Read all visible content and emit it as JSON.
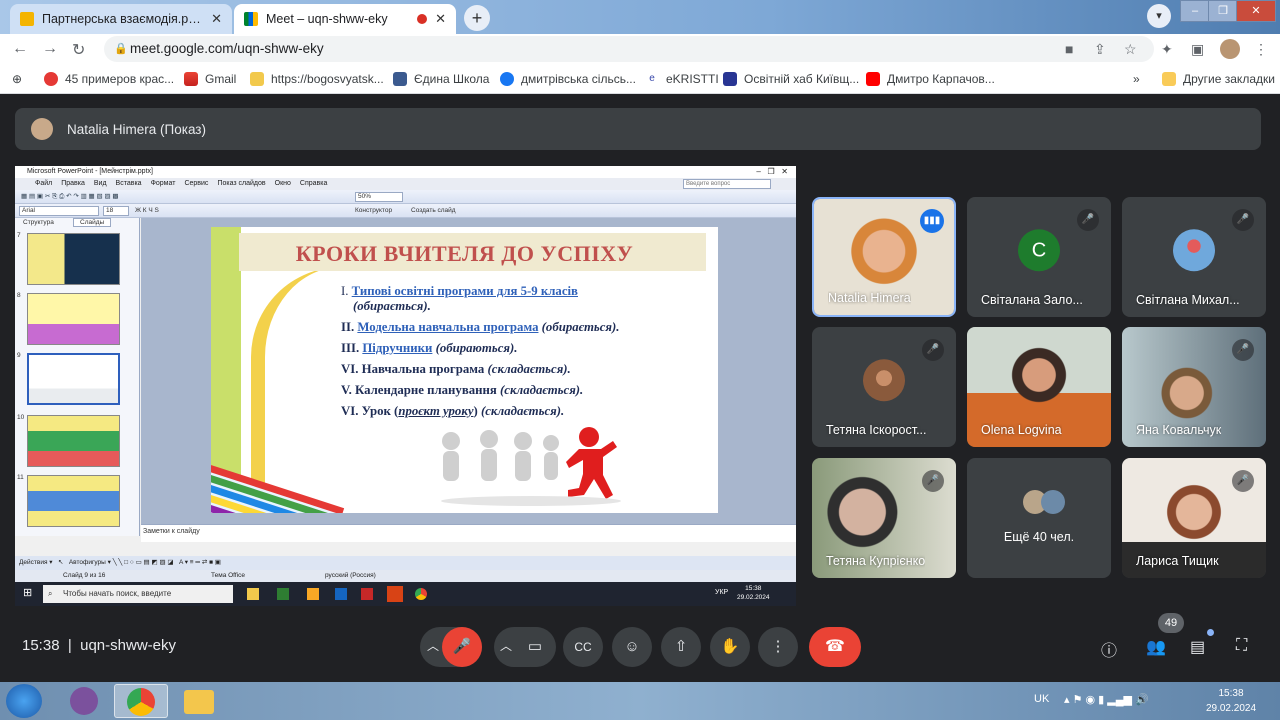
{
  "browser": {
    "tabs": [
      {
        "title": "Партнерська взаємодія.pptx - G",
        "active": false
      },
      {
        "title": "Meet – uqn-shww-eky",
        "active": true
      }
    ],
    "url": "meet.google.com/uqn-shww-eky",
    "bookmarks": [
      "45 примеров крас...",
      "Gmail",
      "https://bogosvyatsk...",
      "Єдина Школа",
      "дмитрівська сільсь...",
      "eKRISTTI",
      "Освітній хаб Київщ...",
      "Дмитро Карпачов..."
    ],
    "other_bookmarks": "Другие закладки",
    "more": "»"
  },
  "meet": {
    "presenter_banner": "Natalia Himera (Показ)",
    "participants": [
      {
        "name": "Natalia Himera",
        "speaking": true,
        "type": "video"
      },
      {
        "name": "Світалана Зало...",
        "type": "letter",
        "letter": "C",
        "muted": true
      },
      {
        "name": "Світлана Михал...",
        "type": "avatar",
        "muted": true
      },
      {
        "name": "Тетяна Іскорост...",
        "type": "avatar",
        "muted": true
      },
      {
        "name": "Olena Logvina",
        "type": "video"
      },
      {
        "name": "Яна Ковальчук",
        "type": "video",
        "muted": true
      },
      {
        "name": "Тетяна Купрієнко",
        "type": "video",
        "muted": true
      },
      {
        "name": "Ещё 40 чел.",
        "type": "more"
      },
      {
        "name": "Лариса Тищик",
        "type": "video",
        "muted": true
      }
    ],
    "time": "15:38",
    "meeting_code": "uqn-shww-eky",
    "people_count": "49"
  },
  "ppt": {
    "window_title": "Microsoft PowerPoint - [Мейнстрім.pptx]",
    "menus": [
      "Файл",
      "Правка",
      "Вид",
      "Вставка",
      "Формат",
      "Сервис",
      "Показ слайдов",
      "Окно",
      "Справка"
    ],
    "help_placeholder": "Введите вопрос",
    "font": "Arial",
    "font_size": "18",
    "zoom": "50%",
    "constructor": "Конструктор",
    "create_slide": "Создать слайд",
    "panel_tabs": [
      "Структура",
      "Слайды"
    ],
    "slide_numbers": [
      "7",
      "8",
      "9",
      "10",
      "11"
    ],
    "notes": "Заметки к слайду",
    "draw_actions": "Действия",
    "autoshapes": "Автофигуры",
    "status_slide": "Слайд 9 из 16",
    "status_theme": "Тема Office",
    "status_lang": "русский (Россия)",
    "win_search": "Чтобы начать поиск, введите",
    "win_lang": "УКР",
    "win_time": "15:38",
    "win_date": "29.02.2024"
  },
  "slide": {
    "title": "КРОКИ ВЧИТЕЛЯ ДО УСПІХУ",
    "items": [
      {
        "num": "I.",
        "link": "Типові освітні програми для 5-9 класів",
        "rest": "",
        "note": "(обирається)."
      },
      {
        "num": "II.",
        "link": "Модельна навчальна програма",
        "rest": "(обирається)."
      },
      {
        "num": "III.",
        "link": "Підручники",
        "rest": "(обираються)."
      },
      {
        "num": "VI.",
        "text": "Навчальна програма",
        "rest": "(складається)."
      },
      {
        "num": "V.",
        "text": "Календарне планування",
        "rest": "(складається)."
      },
      {
        "num": "VI.",
        "text": "Урок (",
        "em": "проєкт уроку",
        "text2": ")",
        "rest": "(складається)."
      }
    ]
  },
  "os": {
    "lang": "UK",
    "time": "15:38",
    "date": "29.02.2024"
  }
}
